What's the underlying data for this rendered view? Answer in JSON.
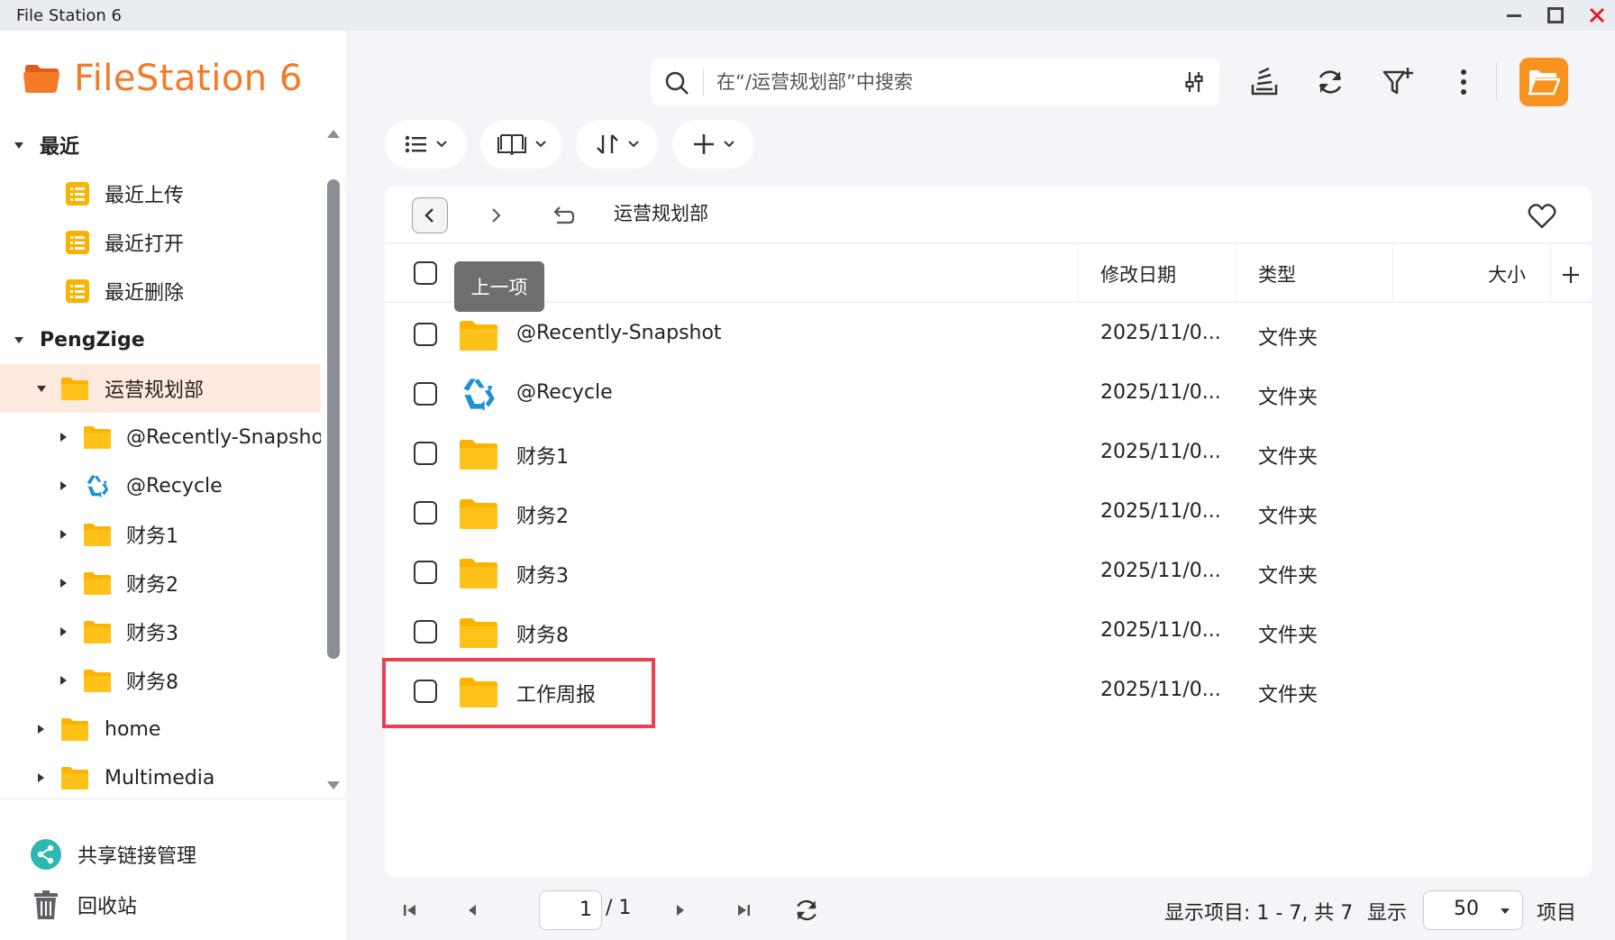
{
  "window": {
    "title": "File Station 6",
    "controls": [
      "minimize",
      "maximize",
      "close"
    ]
  },
  "sidebar": {
    "logo_text": "FileStation 6",
    "tree": [
      {
        "label": "最近",
        "kind": "section",
        "expanded": true
      },
      {
        "label": "最近上传",
        "kind": "recent",
        "icon": "list-icon"
      },
      {
        "label": "最近打开",
        "kind": "recent",
        "icon": "list-icon"
      },
      {
        "label": "最近删除",
        "kind": "recent",
        "icon": "list-icon"
      },
      {
        "label": "PengZige",
        "kind": "section",
        "expanded": true
      },
      {
        "label": "运营规划部",
        "kind": "folder",
        "expanded": true,
        "selected": true
      },
      {
        "label": "@Recently-Snapshot",
        "kind": "folder"
      },
      {
        "label": "@Recycle",
        "kind": "recycle"
      },
      {
        "label": "财务1",
        "kind": "folder"
      },
      {
        "label": "财务2",
        "kind": "folder"
      },
      {
        "label": "财务3",
        "kind": "folder"
      },
      {
        "label": "财务8",
        "kind": "folder"
      },
      {
        "label": "home",
        "kind": "folder"
      },
      {
        "label": "Multimedia",
        "kind": "folder"
      }
    ],
    "share_link_label": "共享链接管理",
    "recycle_bin_label": "回收站"
  },
  "toolbar": {
    "search_placeholder": "在“/运营规划部”中搜索",
    "icons": [
      "search-icon",
      "filter-settings-icon",
      "task-stack-icon",
      "refresh-icon",
      "filter-add-icon",
      "more-icon",
      "open-folder-icon"
    ],
    "pills": [
      "list-view-icon",
      "book-icon",
      "sort-icon",
      "add-icon"
    ]
  },
  "tooltip": "上一项",
  "path": {
    "current": "运营规划部"
  },
  "table": {
    "columns": {
      "modified": "修改日期",
      "type": "类型",
      "size": "大小"
    },
    "rows": [
      {
        "name": "@Recently-Snapshot",
        "date": "2025/11/0...",
        "type": "文件夹",
        "icon": "folder"
      },
      {
        "name": "@Recycle",
        "date": "2025/11/0...",
        "type": "文件夹",
        "icon": "recycle"
      },
      {
        "name": "财务1",
        "date": "2025/11/0...",
        "type": "文件夹",
        "icon": "folder"
      },
      {
        "name": "财务2",
        "date": "2025/11/0...",
        "type": "文件夹",
        "icon": "folder"
      },
      {
        "name": "财务3",
        "date": "2025/11/0...",
        "type": "文件夹",
        "icon": "folder"
      },
      {
        "name": "财务8",
        "date": "2025/11/0...",
        "type": "文件夹",
        "icon": "folder"
      },
      {
        "name": "工作周报",
        "date": "2025/11/0...",
        "type": "文件夹",
        "icon": "folder",
        "highlighted": true
      }
    ]
  },
  "footer": {
    "current_page": "1",
    "total_pages": "/ 1",
    "display_items": "显示项目: 1 - 7, 共 7",
    "show_label": "显示",
    "page_size": "50",
    "items_label": "项目"
  },
  "colors": {
    "accent": "#f47a28",
    "folder": "#fbb300",
    "selected_row": "#fde9dd",
    "highlight_border": "#e8414f"
  }
}
